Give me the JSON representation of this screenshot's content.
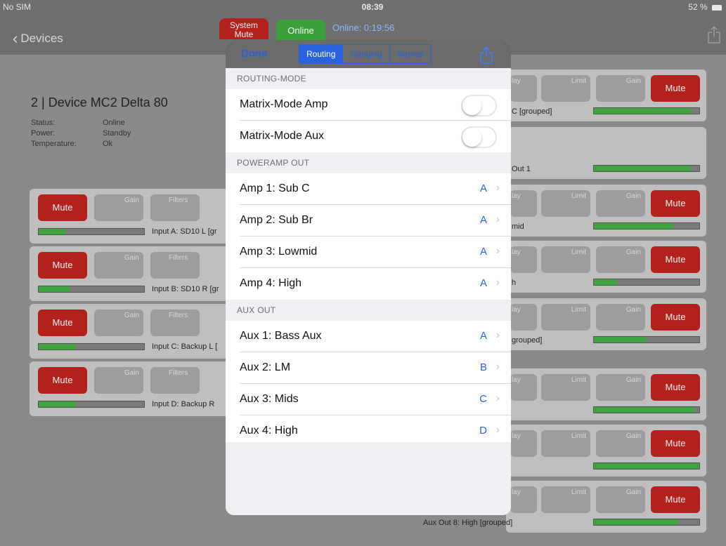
{
  "status_bar": {
    "carrier": "No SIM",
    "time": "08:39",
    "battery": "52 %"
  },
  "nav": {
    "back_label": "Devices",
    "system_mute_label": "System Mute",
    "online_label": "Online",
    "online_time": "Online: 0:19:56"
  },
  "device": {
    "title": "2 | Device MC2 Delta 80",
    "info": [
      {
        "key": "Status:",
        "value": "Online"
      },
      {
        "key": "Power:",
        "value": "Standby"
      },
      {
        "key": "Temperature:",
        "value": "Ok"
      }
    ]
  },
  "inputs": [
    {
      "mute": "Mute",
      "gain": "Gain",
      "filters": "Filters",
      "label": "Input A: SD10 L [gr",
      "level": 0.25
    },
    {
      "mute": "Mute",
      "gain": "Gain",
      "filters": "Filters",
      "label": "Input B: SD10 R [gr",
      "level": 0.3
    },
    {
      "mute": "Mute",
      "gain": "Gain",
      "filters": "Filters",
      "label": "Input C: Backup L [",
      "level": 0.35
    },
    {
      "mute": "Mute",
      "gain": "Gain",
      "filters": "Filters",
      "label": "Input D: Backup R",
      "level": 0.35
    }
  ],
  "outputs": [
    {
      "delay": "lay",
      "limit": "Limit",
      "gain": "Gain",
      "mute": "Mute",
      "label": "C [grouped]",
      "level": 0.92,
      "has_mute": true
    },
    {
      "label": "Out 1",
      "level": 0.92,
      "has_mute": false
    },
    {
      "delay": "lay",
      "limit": "Limit",
      "gain": "Gain",
      "mute": "Mute",
      "label": "mid",
      "level": 0.75,
      "has_mute": true
    },
    {
      "delay": "lay",
      "limit": "Limit",
      "gain": "Gain",
      "mute": "Mute",
      "label": "h",
      "level": 0.22,
      "has_mute": true
    },
    {
      "delay": "lay",
      "limit": "Limit",
      "gain": "Gain",
      "mute": "Mute",
      "label": "grouped]",
      "level": 0.5,
      "has_mute": true
    },
    {
      "delay": "lay",
      "limit": "Limit",
      "gain": "Gain",
      "mute": "Mute",
      "label": "",
      "level": 0.95,
      "has_mute": true
    },
    {
      "delay": "lay",
      "limit": "Limit",
      "gain": "Gain",
      "mute": "Mute",
      "label": "",
      "level": 1.0,
      "has_mute": true
    },
    {
      "delay": "lay",
      "limit": "Limit",
      "gain": "Gain",
      "mute": "Mute",
      "label": "Aux Out 8: High [grouped]",
      "level": 0.8,
      "has_mute": true
    }
  ],
  "modal": {
    "done_label": "Done",
    "segments": [
      "Routing",
      "Ganging",
      "Names"
    ],
    "active_segment": "Routing",
    "sections": [
      {
        "header": "ROUTING-MODE",
        "rows": [
          {
            "label": "Matrix-Mode Amp",
            "toggle": false
          },
          {
            "label": "Matrix-Mode Aux",
            "toggle": false
          }
        ]
      },
      {
        "header": "POWERAMP OUT",
        "rows": [
          {
            "label": "Amp 1: Sub C",
            "value": "A"
          },
          {
            "label": "Amp 2: Sub Br",
            "value": "A"
          },
          {
            "label": "Amp 3: Lowmid",
            "value": "A"
          },
          {
            "label": "Amp 4: High",
            "value": "A"
          }
        ]
      },
      {
        "header": "AUX OUT",
        "rows": [
          {
            "label": "Aux 1: Bass Aux",
            "value": "A"
          },
          {
            "label": "Aux 2: LM",
            "value": "B"
          },
          {
            "label": "Aux 3: Mids",
            "value": "C"
          },
          {
            "label": "Aux 4: High",
            "value": "D"
          }
        ]
      }
    ]
  },
  "colors": {
    "accent": "#2a62e0",
    "mute_red": "#b3211c",
    "online_green": "#3a9e39",
    "meter_green": "#3fa43e"
  }
}
